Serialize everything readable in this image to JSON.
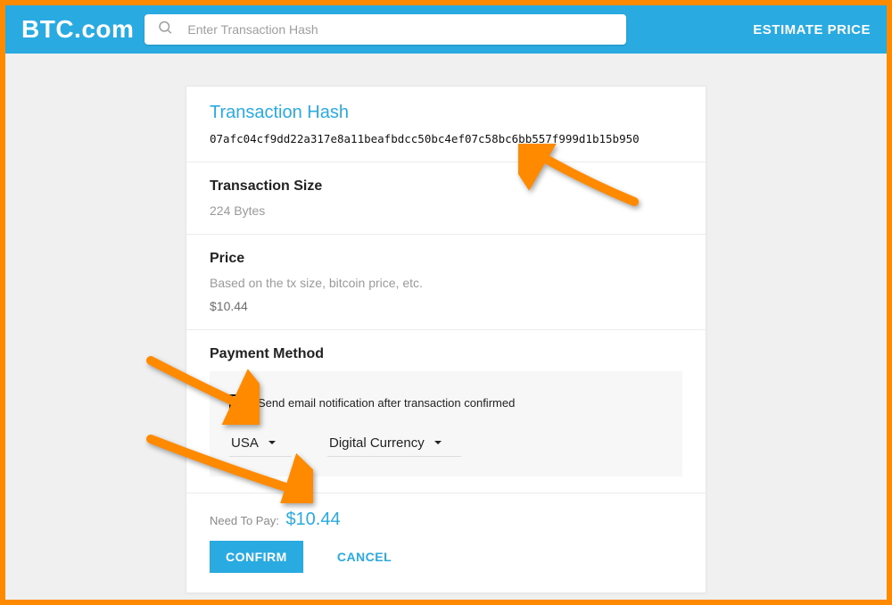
{
  "header": {
    "logo_text": "BTC.com",
    "search_placeholder": "Enter Transaction Hash",
    "estimate_label": "ESTIMATE PRICE"
  },
  "tx": {
    "hash_title": "Transaction Hash",
    "hash_value": "07afc04cf9dd22a317e8a11beafbdcc50bc4ef07c58bc6bb557f999d1b15b950",
    "size_title": "Transaction Size",
    "size_value": "224 Bytes",
    "price_title": "Price",
    "price_desc": "Based on the tx size, bitcoin price, etc.",
    "price_value": "$10.44"
  },
  "payment": {
    "title": "Payment Method",
    "email_label": "Send email notification after transaction confirmed",
    "country_selected": "USA",
    "method_selected": "Digital Currency"
  },
  "footer": {
    "need_label": "Need To Pay:",
    "amount": "$10.44",
    "confirm_label": "CONFIRM",
    "cancel_label": "CANCEL"
  },
  "colors": {
    "accent": "#29abe2",
    "frame": "#ff8a00"
  }
}
